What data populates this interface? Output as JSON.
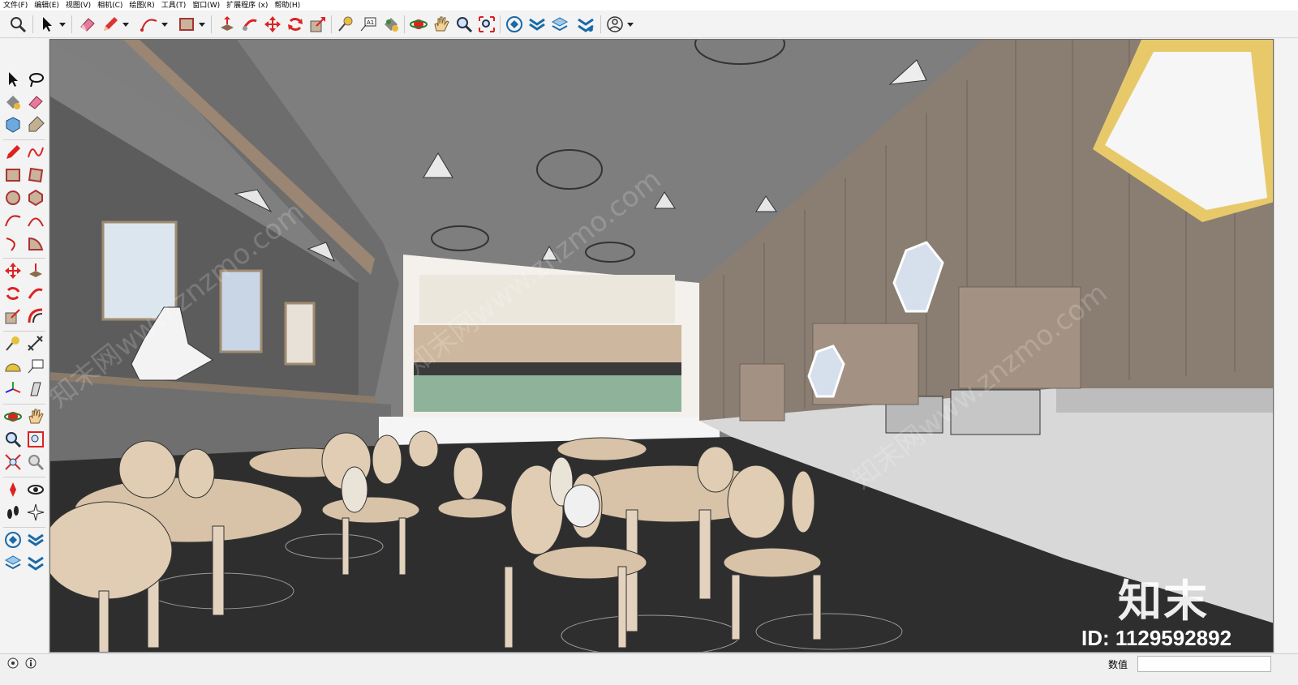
{
  "menu": {
    "file": "文件(F)",
    "edit": "编辑(E)",
    "view": "视图(V)",
    "camera": "相机(C)",
    "draw": "绘图(R)",
    "tools": "工具(T)",
    "window": "窗口(W)",
    "extensions": "扩展程序 (x)",
    "help": "帮助(H)"
  },
  "toolbar_icons": [
    "zoom-extents-icon",
    "select-icon",
    "eraser-icon",
    "pencil-icon",
    "arc-icon",
    "rectangle-icon",
    "push-pull-icon",
    "follow-me-icon",
    "move-icon",
    "rotate-icon",
    "scale-icon",
    "tape-measure-icon",
    "text-icon",
    "paint-bucket-icon",
    "orbit-icon",
    "pan-icon",
    "zoom-icon",
    "zoom-window-icon",
    "warehouse-icon",
    "extension-warehouse-icon",
    "layers-icon",
    "send-to-layout-icon",
    "account-icon"
  ],
  "watermark": {
    "logo": "知末",
    "id": "ID: 1129592892",
    "diagonal": "知末网www.znzmo.com"
  },
  "status": {
    "measure_label": "数值",
    "measure_value": ""
  },
  "colors": {
    "ceiling": "#7e7e7e",
    "wood_wall": "#8a7d72",
    "floor": "#2e2e2e",
    "furniture": "#d8c3a8",
    "accent_yellow": "#e8c96a",
    "tile_green": "#8fb39a"
  }
}
